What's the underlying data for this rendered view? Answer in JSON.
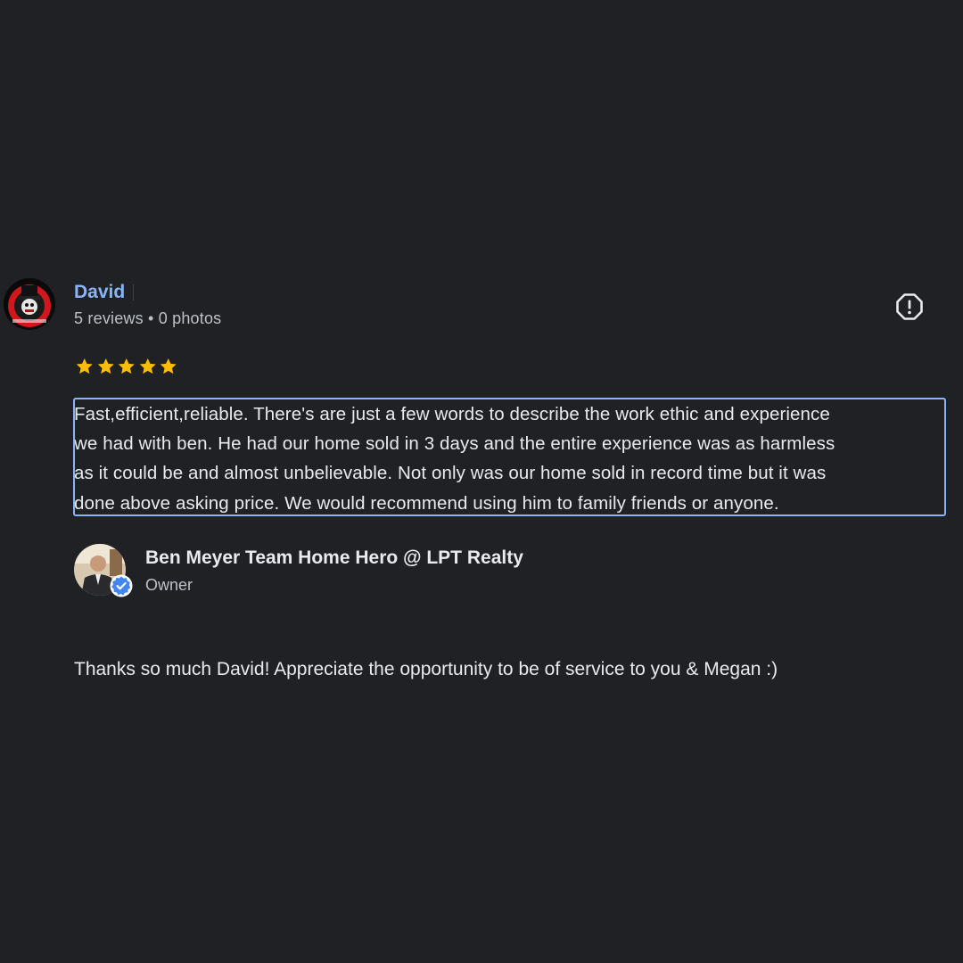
{
  "review": {
    "reviewer": {
      "name": "David",
      "meta": "5 reviews • 0 photos"
    },
    "rating": 5,
    "star_color": "#fbbc04",
    "text_lines": [
      "Fast,efficient,reliable. There's are just a few words to describe the work ethic and experience",
      "we had with ben. He had our home sold in 3 days and the entire experience was as harmless",
      "as it could be and almost unbelievable. Not only was our home sold in record time but it was",
      "done above asking price. We would recommend using him to family friends or anyone."
    ],
    "owner": {
      "name": "Ben Meyer Team Home Hero @ LPT Realty",
      "role": "Owner",
      "reply": "Thanks so much David! Appreciate the opportunity to be of service to you & Megan :)"
    }
  },
  "colors": {
    "background": "#202124",
    "link": "#8ab4f8",
    "text": "#e8eaed",
    "secondary_text": "#bdc1c6",
    "verified": "#4285f4"
  },
  "icons": {
    "report": "report-icon",
    "star": "star-icon",
    "verified": "verified-badge-icon"
  }
}
